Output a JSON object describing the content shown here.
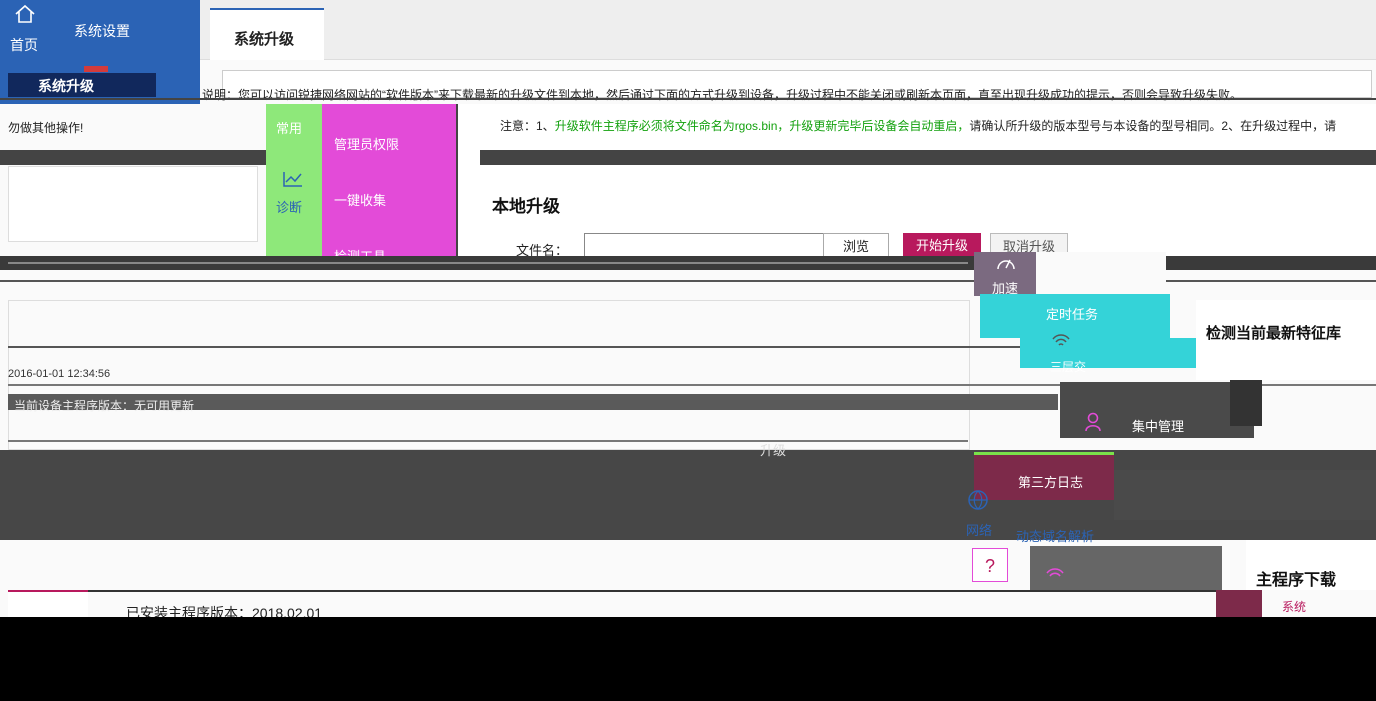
{
  "nav": {
    "home_label": "首页",
    "settings_label": "系统设置",
    "upgrade_label": "系统升级"
  },
  "tabs": {
    "active": "系统升级"
  },
  "notice": {
    "desc": "说明：您可以访问锐捷网络网站的“软件版本”来下载最新的升级文件到本地，然后通过下面的方式升级到设备，升级过程中不能关闭或刷新本页面，直至出现升级成功的提示，否则会导致升级失败。",
    "desc_tail": "勿做其他操作!",
    "caution_prefix": "注意：1、",
    "caution_green": "升级软件主程序必须将文件命名为rgos.bin，升级更新完毕后设备会自动重启，",
    "caution_rest": "请确认所升级的版本型号与本设备的型号相同。2、在升级过程中，请"
  },
  "overlay_menu": {
    "common": "常用",
    "admin_perm": "管理员权限",
    "one_click": "一键收集",
    "diagnose": "诊断",
    "detect": "检测工具"
  },
  "local_upgrade": {
    "title": "本地升级",
    "file_label": "文件名：",
    "browse": "浏览",
    "start": "开始升级",
    "cancel": "取消升级"
  },
  "right_menu": {
    "speed": "加速",
    "timer": "定时任务",
    "wireless": "无线",
    "ap": "三层交",
    "center_mgmt": "集中管理",
    "third_log": "第三方日志",
    "network": "网络",
    "ddns": "动态域名解析",
    "help": "?",
    "system": "系统"
  },
  "online": {
    "check_title": "检测当前最新特征库",
    "main_download": "主程序下载"
  },
  "history": {
    "date_row": "2016-01-01 12:34:56",
    "summary": "当前设备主程序版本：无可用更新",
    "current_version": "已安装主程序版本：2018.02.01"
  },
  "mid_text": "升级",
  "colors": {
    "nav_blue": "#2b63b5",
    "magenta": "#e34bd8",
    "green": "#13a10e",
    "accent": "#b8195d"
  }
}
